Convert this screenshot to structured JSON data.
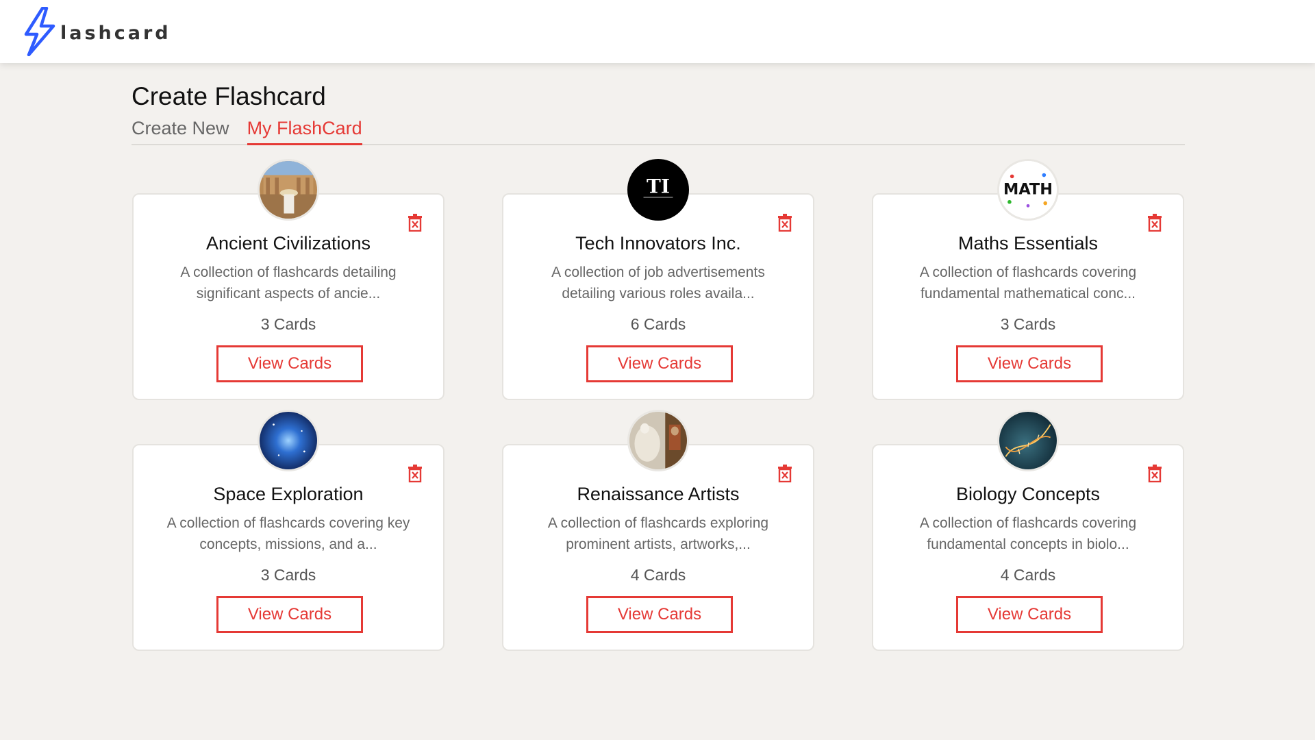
{
  "app": {
    "logo_text": "lashcard",
    "accent_color": "#e53935",
    "logo_color": "#2e5bff"
  },
  "page": {
    "title": "Create Flashcard"
  },
  "tabs": [
    {
      "label": "Create New",
      "active": false
    },
    {
      "label": "My FlashCard",
      "active": true
    }
  ],
  "cards": [
    {
      "title": "Ancient Civilizations",
      "description": "A collection of flashcards detailing significant aspects of ancie...",
      "count": "3 Cards",
      "button": "View Cards",
      "image": "ancient-ruins-photo"
    },
    {
      "title": "Tech Innovators Inc.",
      "description": "A collection of job advertisements detailing various roles availa...",
      "count": "6 Cards",
      "button": "View Cards",
      "image": "ti-logo",
      "image_text": "TI"
    },
    {
      "title": "Maths Essentials",
      "description": "A collection of flashcards covering fundamental mathematical conc...",
      "count": "3 Cards",
      "button": "View Cards",
      "image": "math-logo",
      "image_text": "MATH"
    },
    {
      "title": "Space Exploration",
      "description": "A collection of flashcards covering key concepts, missions, and a...",
      "count": "3 Cards",
      "button": "View Cards",
      "image": "galaxy-photo"
    },
    {
      "title": "Renaissance Artists",
      "description": "A collection of flashcards exploring prominent artists, artworks,...",
      "count": "4 Cards",
      "button": "View Cards",
      "image": "sculpture-painting-photo"
    },
    {
      "title": "Biology Concepts",
      "description": "A collection of flashcards covering fundamental concepts in biolo...",
      "count": "4 Cards",
      "button": "View Cards",
      "image": "dna-helix-photo"
    }
  ]
}
